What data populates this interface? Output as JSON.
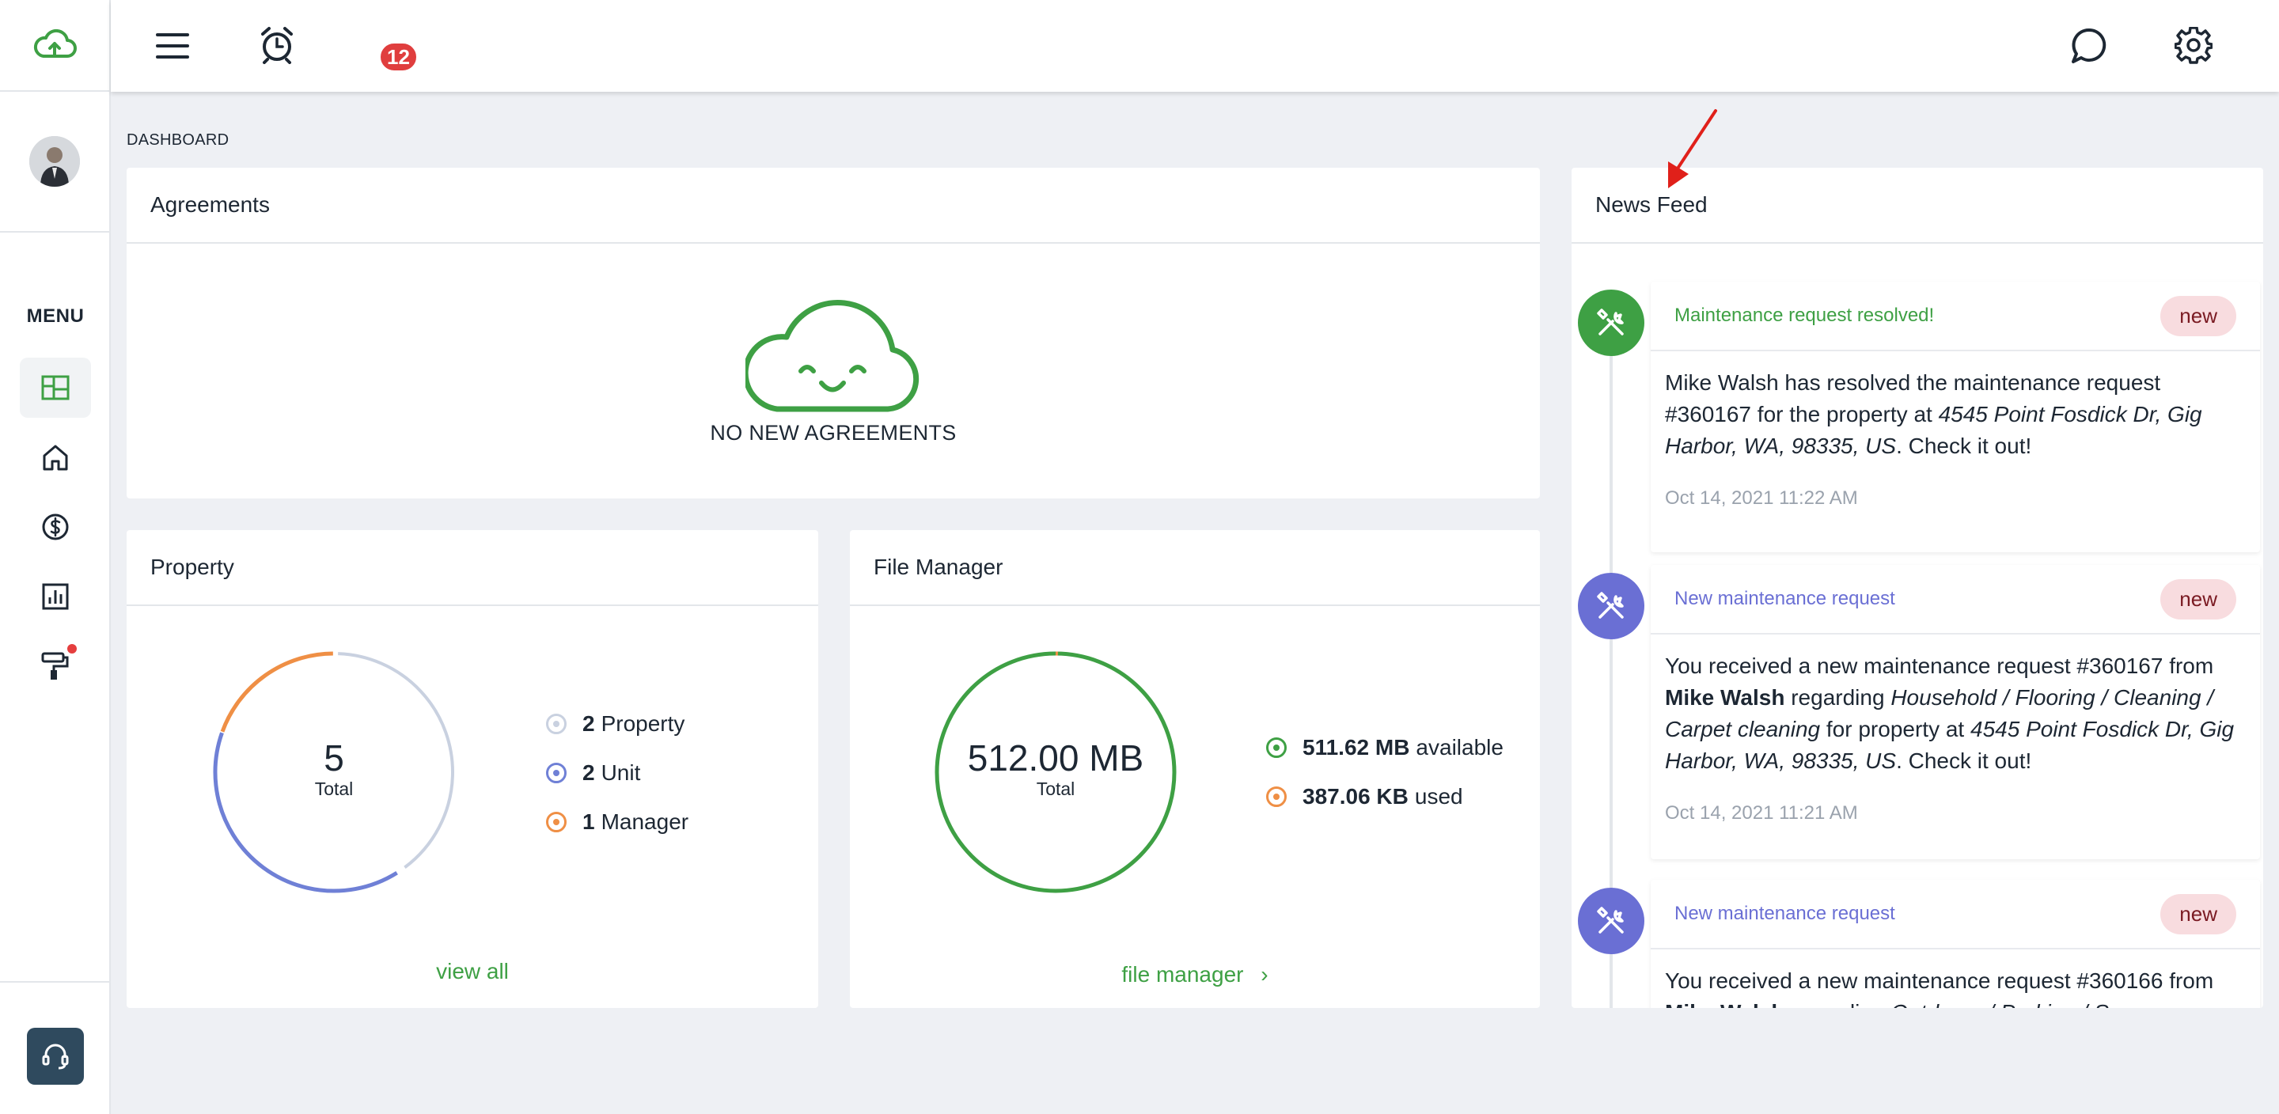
{
  "topbar": {
    "notification_count": "12"
  },
  "sidebar": {
    "menu_label": "MENU",
    "items": [
      {
        "icon": "dashboard-icon",
        "active": true
      },
      {
        "icon": "home-icon",
        "active": false
      },
      {
        "icon": "dollar-icon",
        "active": false
      },
      {
        "icon": "bar-chart-icon",
        "active": false
      },
      {
        "icon": "paint-roller-icon",
        "active": false
      }
    ]
  },
  "breadcrumb": "DASHBOARD",
  "agreements": {
    "title": "Agreements",
    "empty_text": "NO NEW AGREEMENTS"
  },
  "property": {
    "title": "Property",
    "total_value": "5",
    "total_label": "Total",
    "legend": [
      {
        "count": "2",
        "label": "Property",
        "color": "#c9d1e0"
      },
      {
        "count": "2",
        "label": "Unit",
        "color": "#6f80d6"
      },
      {
        "count": "1",
        "label": "Manager",
        "color": "#ef8f45"
      }
    ],
    "link": "view all"
  },
  "file_manager": {
    "title": "File Manager",
    "total_value": "512.00 MB",
    "total_label": "Total",
    "legend": [
      {
        "value": "511.62 MB",
        "label": "available",
        "color": "#3ea044"
      },
      {
        "value": "387.06 KB",
        "label": "used",
        "color": "#ef8f45"
      }
    ],
    "link": "file manager",
    "link_arrow": "›"
  },
  "news_feed": {
    "title": "News Feed",
    "items": [
      {
        "title": "Maintenance request resolved!",
        "title_color": "#3ea044",
        "icon_bg": "#3ea044",
        "badge": "new",
        "body_parts": [
          {
            "t": "Mike Walsh has resolved the maintenance request #360167 for the property at "
          },
          {
            "t": "4545 Point Fosdick Dr, Gig Harbor, WA, 98335, US",
            "i": true
          },
          {
            "t": ". Check it out!"
          }
        ],
        "time": "Oct 14, 2021 11:22 AM"
      },
      {
        "title": "New maintenance request",
        "title_color": "#6a6fd4",
        "icon_bg": "#6a6fd4",
        "badge": "new",
        "body_parts": [
          {
            "t": "You received a new maintenance request #360167 from "
          },
          {
            "t": "Mike Walsh",
            "b": true
          },
          {
            "t": " regarding "
          },
          {
            "t": "Household / Flooring / Cleaning / Carpet cleaning",
            "i": true
          },
          {
            "t": " for property at "
          },
          {
            "t": "4545 Point Fosdick Dr, Gig Harbor, WA, 98335, US",
            "i": true
          },
          {
            "t": ". Check it out!"
          }
        ],
        "time": "Oct 14, 2021 11:21 AM"
      },
      {
        "title": "New maintenance request",
        "title_color": "#6a6fd4",
        "icon_bg": "#6a6fd4",
        "badge": "new",
        "body_parts": [
          {
            "t": "You received a new maintenance request #360166 from "
          },
          {
            "t": "Mike Walsh",
            "b": true
          },
          {
            "t": " regarding "
          },
          {
            "t": "Outdoors / Parking / Snow",
            "i": true
          }
        ],
        "time": ""
      }
    ]
  },
  "colors": {
    "brand_green": "#3ea044",
    "accent_purple": "#6a6fd4",
    "accent_orange": "#ef8f45",
    "annotation_red": "#e0201a"
  }
}
